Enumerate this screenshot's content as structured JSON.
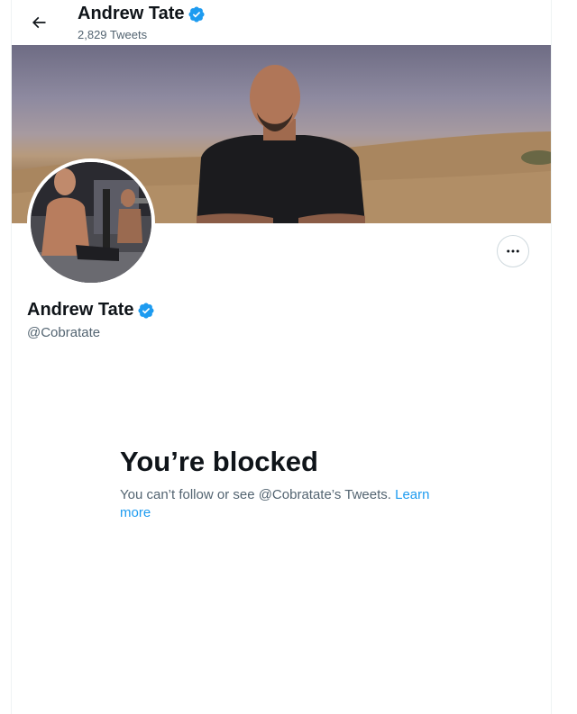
{
  "header": {
    "name": "Andrew Tate",
    "tweet_count": "2,829 Tweets",
    "back_icon": "arrow-left-icon"
  },
  "profile": {
    "name": "Andrew Tate",
    "handle": "@Cobratate",
    "verified": true,
    "verified_color": "#1d9bf0",
    "more_icon": "ellipsis-icon"
  },
  "blocked": {
    "title": "You’re blocked",
    "message": "You can’t follow or see @Cobratate’s Tweets.",
    "link_label": "Learn more"
  },
  "colors": {
    "accent": "#1d9bf0",
    "text_primary": "#0f1419",
    "text_secondary": "#536471"
  }
}
